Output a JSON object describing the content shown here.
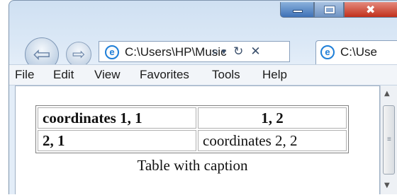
{
  "window": {
    "min_icon": "minimize-icon",
    "max_icon": "maximize-icon",
    "close_icon": "close-icon",
    "close_glyph": "✖"
  },
  "nav": {
    "back_glyph": "⇦",
    "forward_glyph": "⇨"
  },
  "address": {
    "text": "C:\\Users\\HP\\Music",
    "search_glyph": "⌕",
    "dropdown_glyph": "▾",
    "refresh_glyph": "↻",
    "stop_glyph": "✕"
  },
  "tab": {
    "label": "C:\\Use"
  },
  "menu": {
    "items": [
      "File",
      "Edit",
      "View",
      "Favorites",
      "Tools",
      "Help"
    ]
  },
  "table": {
    "rows": [
      [
        "coordinates 1, 1",
        "1, 2"
      ],
      [
        "2, 1",
        "coordinates 2, 2"
      ]
    ],
    "caption": "Table with caption"
  },
  "scrollbar": {
    "up_glyph": "▲",
    "down_glyph": "▼",
    "grip_glyph": "≡"
  },
  "colors": {
    "accent": "#1f7fd8",
    "close": "#c1301c"
  }
}
